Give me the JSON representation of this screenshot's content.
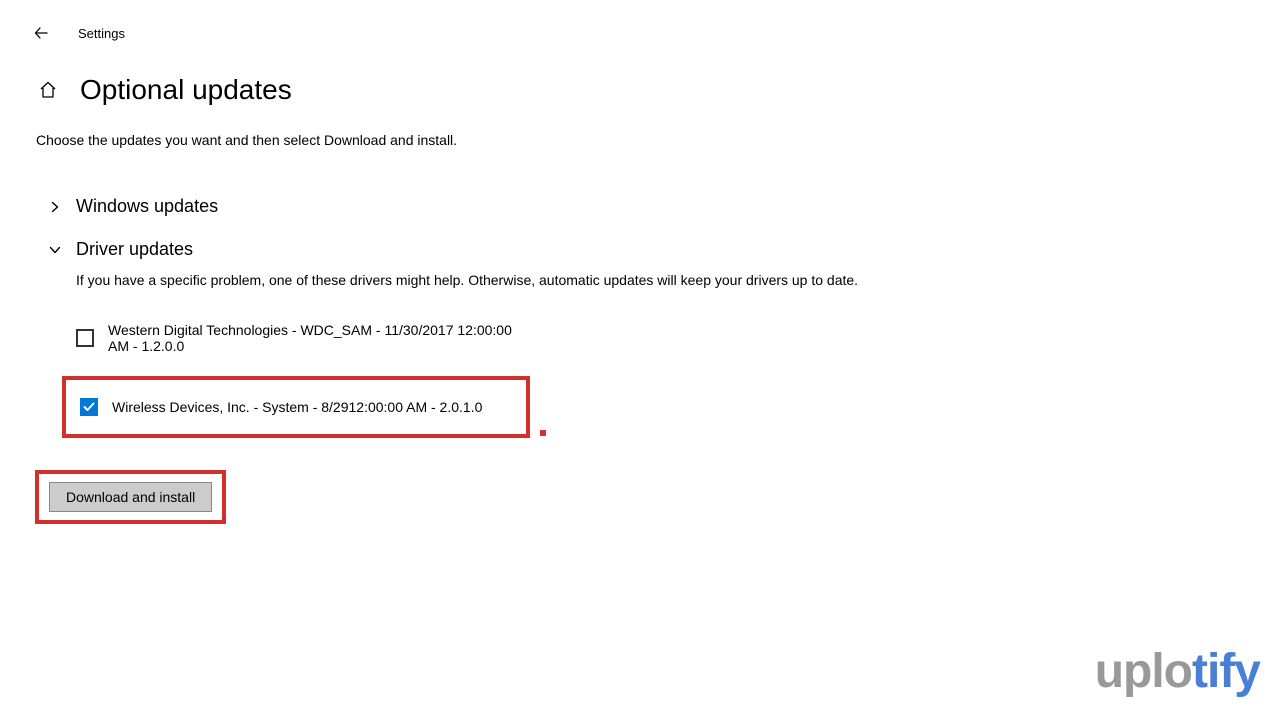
{
  "topbar": {
    "app_label": "Settings"
  },
  "page": {
    "title": "Optional updates",
    "subtitle": "Choose the updates you want and then select Download and install."
  },
  "sections": {
    "windows_updates": {
      "title": "Windows updates",
      "expanded": false
    },
    "driver_updates": {
      "title": "Driver updates",
      "expanded": true,
      "description": "If you have a specific problem, one of these drivers might help. Otherwise, automatic updates will keep your drivers up to date.",
      "items": [
        {
          "label": "Western Digital Technologies - WDC_SAM - 11/30/2017 12:00:00 AM - 1.2.0.0",
          "checked": false,
          "highlighted": false
        },
        {
          "label": "Wireless Devices, Inc. - System - 8/2912:00:00 AM - 2.0.1.0",
          "checked": true,
          "highlighted": true
        }
      ]
    }
  },
  "button": {
    "download_install": "Download and install"
  },
  "watermark": {
    "part1": "uplo",
    "part2": "tify"
  }
}
